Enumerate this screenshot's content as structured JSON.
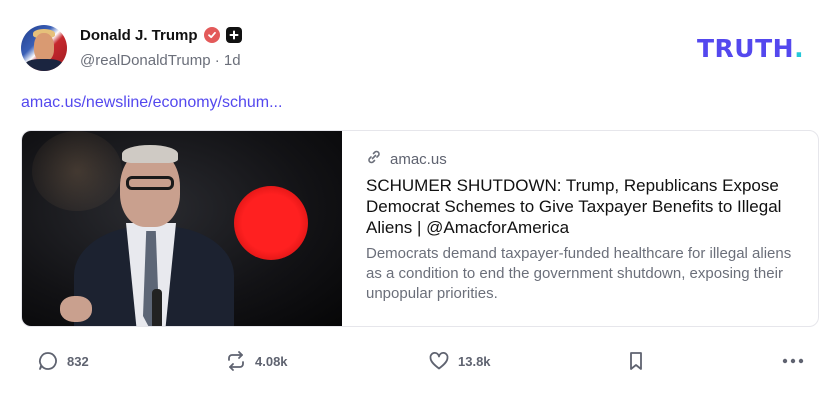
{
  "author": {
    "display_name": "Donald J. Trump",
    "handle": "@realDonaldTrump",
    "time_ago": "1d"
  },
  "brand": {
    "logo_text": "TRUTH",
    "logo_dot": ".",
    "accent_color": "#5448ee",
    "dot_color": "#24c7d9"
  },
  "post": {
    "link_text": "amac.us/newsline/economy/schum..."
  },
  "card": {
    "domain": "amac.us",
    "title": "SCHUMER SHUTDOWN: Trump, Republicans Expose Democrat Schemes to Give Taxpayer Benefits to Illegal Aliens | @AmacforAmerica",
    "description": "Democrats demand taxpayer-funded healthcare for illegal aliens as a condition to end the government shutdown, exposing their unpopular priorities."
  },
  "actions": {
    "replies": "832",
    "retruths": "4.08k",
    "likes": "13.8k"
  },
  "icons": [
    "verified-badge-icon",
    "plus-badge-icon",
    "link-icon",
    "reply-icon",
    "retruth-icon",
    "heart-icon",
    "bookmark-icon",
    "more-icon"
  ]
}
